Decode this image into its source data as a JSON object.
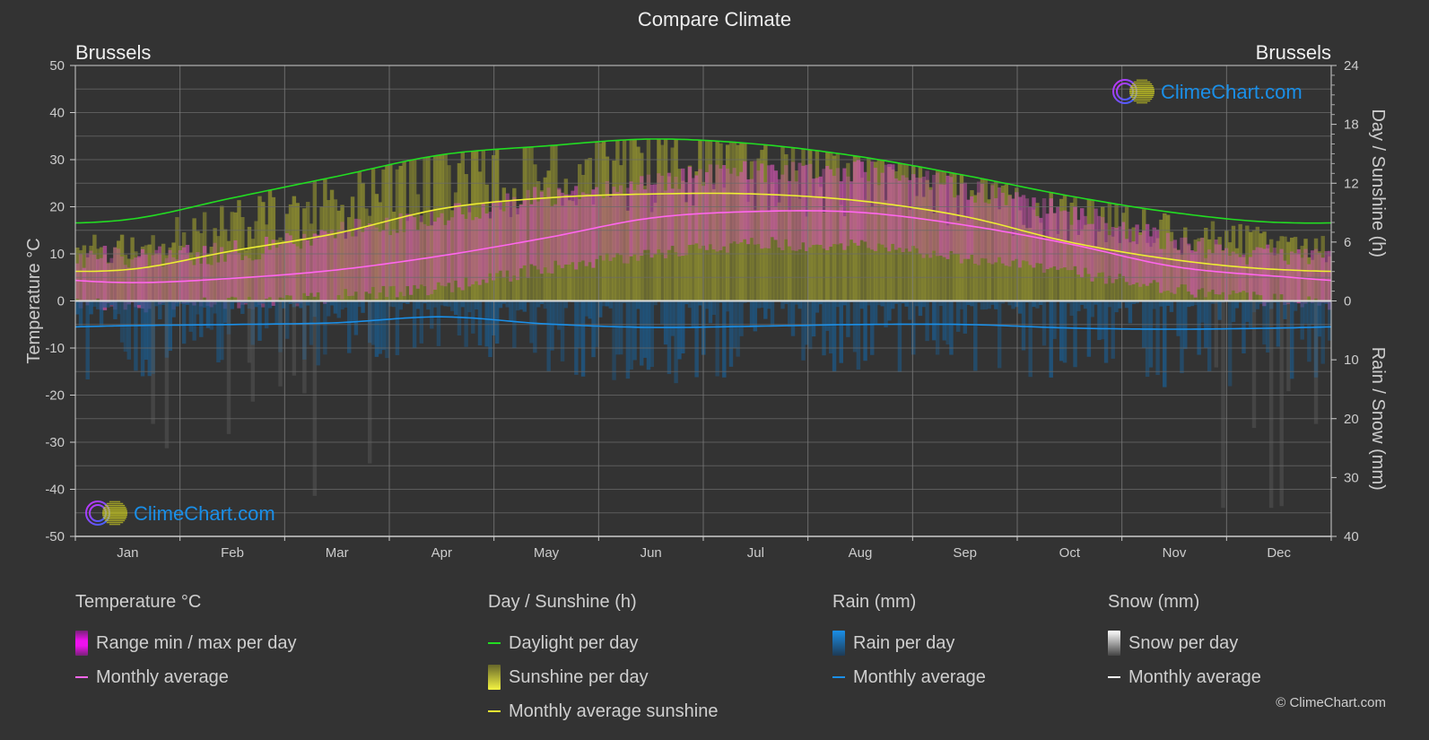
{
  "page": {
    "title": "Compare Climate",
    "city_left": "Brussels",
    "city_right": "Brussels",
    "copyright": "© ClimeChart.com",
    "watermark": "ClimeChart.com"
  },
  "legend": {
    "temperature": {
      "heading": "Temperature °C",
      "items": [
        {
          "label": "Range min / max per day",
          "icon": "range-bar-icon"
        },
        {
          "label": "Monthly average",
          "icon": "line-icon"
        }
      ]
    },
    "sunshine": {
      "heading": "Day / Sunshine (h)",
      "items": [
        {
          "label": "Daylight per day",
          "icon": "line-icon"
        },
        {
          "label": "Sunshine per day",
          "icon": "sunshine-bar-icon"
        },
        {
          "label": "Monthly average sunshine",
          "icon": "line-icon"
        }
      ]
    },
    "rain": {
      "heading": "Rain (mm)",
      "items": [
        {
          "label": "Rain per day",
          "icon": "rain-bar-icon"
        },
        {
          "label": "Monthly average",
          "icon": "line-icon"
        }
      ]
    },
    "snow": {
      "heading": "Snow (mm)",
      "items": [
        {
          "label": "Snow per day",
          "icon": "snow-bar-icon"
        },
        {
          "label": "Monthly average",
          "icon": "line-icon"
        }
      ]
    }
  },
  "colors": {
    "background": "#333333",
    "grid": "#555555",
    "temp_avg": "#ff66ee",
    "temp_range": "#cc33cc",
    "daylight": "#22dd22",
    "sunshine_avg": "#eeee33",
    "sunshine_bar": "#8f8f30",
    "rain_avg": "#1a8fe8",
    "rain_bar": "#1c5a8a",
    "snow_avg": "#ffffff",
    "snow_bar": "#5a5a5a",
    "watermark": "#1a8fe8"
  },
  "chart_data": {
    "type": "line",
    "title": "Compare Climate",
    "categories": [
      "Jan",
      "Feb",
      "Mar",
      "Apr",
      "May",
      "Jun",
      "Jul",
      "Aug",
      "Sep",
      "Oct",
      "Nov",
      "Dec"
    ],
    "axes": {
      "left": {
        "label": "Temperature °C",
        "range": [
          -50,
          50
        ],
        "ticks": [
          50,
          40,
          30,
          20,
          10,
          0,
          -10,
          -20,
          -30,
          -40,
          -50
        ]
      },
      "right_top": {
        "label": "Day / Sunshine (h)",
        "range": [
          0,
          24
        ],
        "ticks": [
          24,
          18,
          12,
          6,
          0
        ]
      },
      "right_bottom": {
        "label": "Rain / Snow (mm)",
        "range": [
          0,
          40
        ],
        "ticks": [
          0,
          10,
          20,
          30,
          40
        ]
      }
    },
    "grid": true,
    "legend_position": "bottom",
    "series": [
      {
        "name": "Temperature monthly average",
        "axis": "left",
        "unit": "°C",
        "values": [
          3.9,
          4.8,
          6.6,
          9.6,
          13.4,
          17.6,
          19.0,
          18.8,
          16.1,
          12.1,
          7.3,
          5.2
        ]
      },
      {
        "name": "Daylight per day",
        "axis": "right_top",
        "unit": "h",
        "values": [
          8.3,
          10.5,
          12.7,
          14.9,
          15.8,
          16.5,
          16.0,
          14.7,
          12.8,
          10.7,
          9.0,
          8.0
        ]
      },
      {
        "name": "Monthly average sunshine",
        "axis": "right_top",
        "unit": "h",
        "values": [
          3.2,
          5.1,
          6.9,
          9.4,
          10.5,
          10.9,
          10.9,
          10.2,
          8.6,
          6.0,
          4.2,
          3.2
        ]
      },
      {
        "name": "Rain monthly average",
        "axis": "right_bottom",
        "unit": "mm",
        "values": [
          4.2,
          4.0,
          3.7,
          2.7,
          3.9,
          4.5,
          4.3,
          4.0,
          4.0,
          4.6,
          4.8,
          4.6
        ]
      },
      {
        "name": "Snow monthly average",
        "axis": "right_bottom",
        "unit": "mm",
        "values": [
          0.1,
          0.1,
          0.0,
          0.0,
          0.0,
          0.0,
          0.0,
          0.0,
          0.0,
          0.0,
          0.0,
          0.1
        ]
      }
    ],
    "temperature_range_approx": {
      "min": [
        0.5,
        1.0,
        2.5,
        4.5,
        8.5,
        11.5,
        13.5,
        13.0,
        10.5,
        7.5,
        4.0,
        1.5
      ],
      "max": [
        7,
        8,
        12,
        16,
        20,
        23,
        25,
        25,
        21,
        16,
        10,
        7
      ]
    }
  }
}
